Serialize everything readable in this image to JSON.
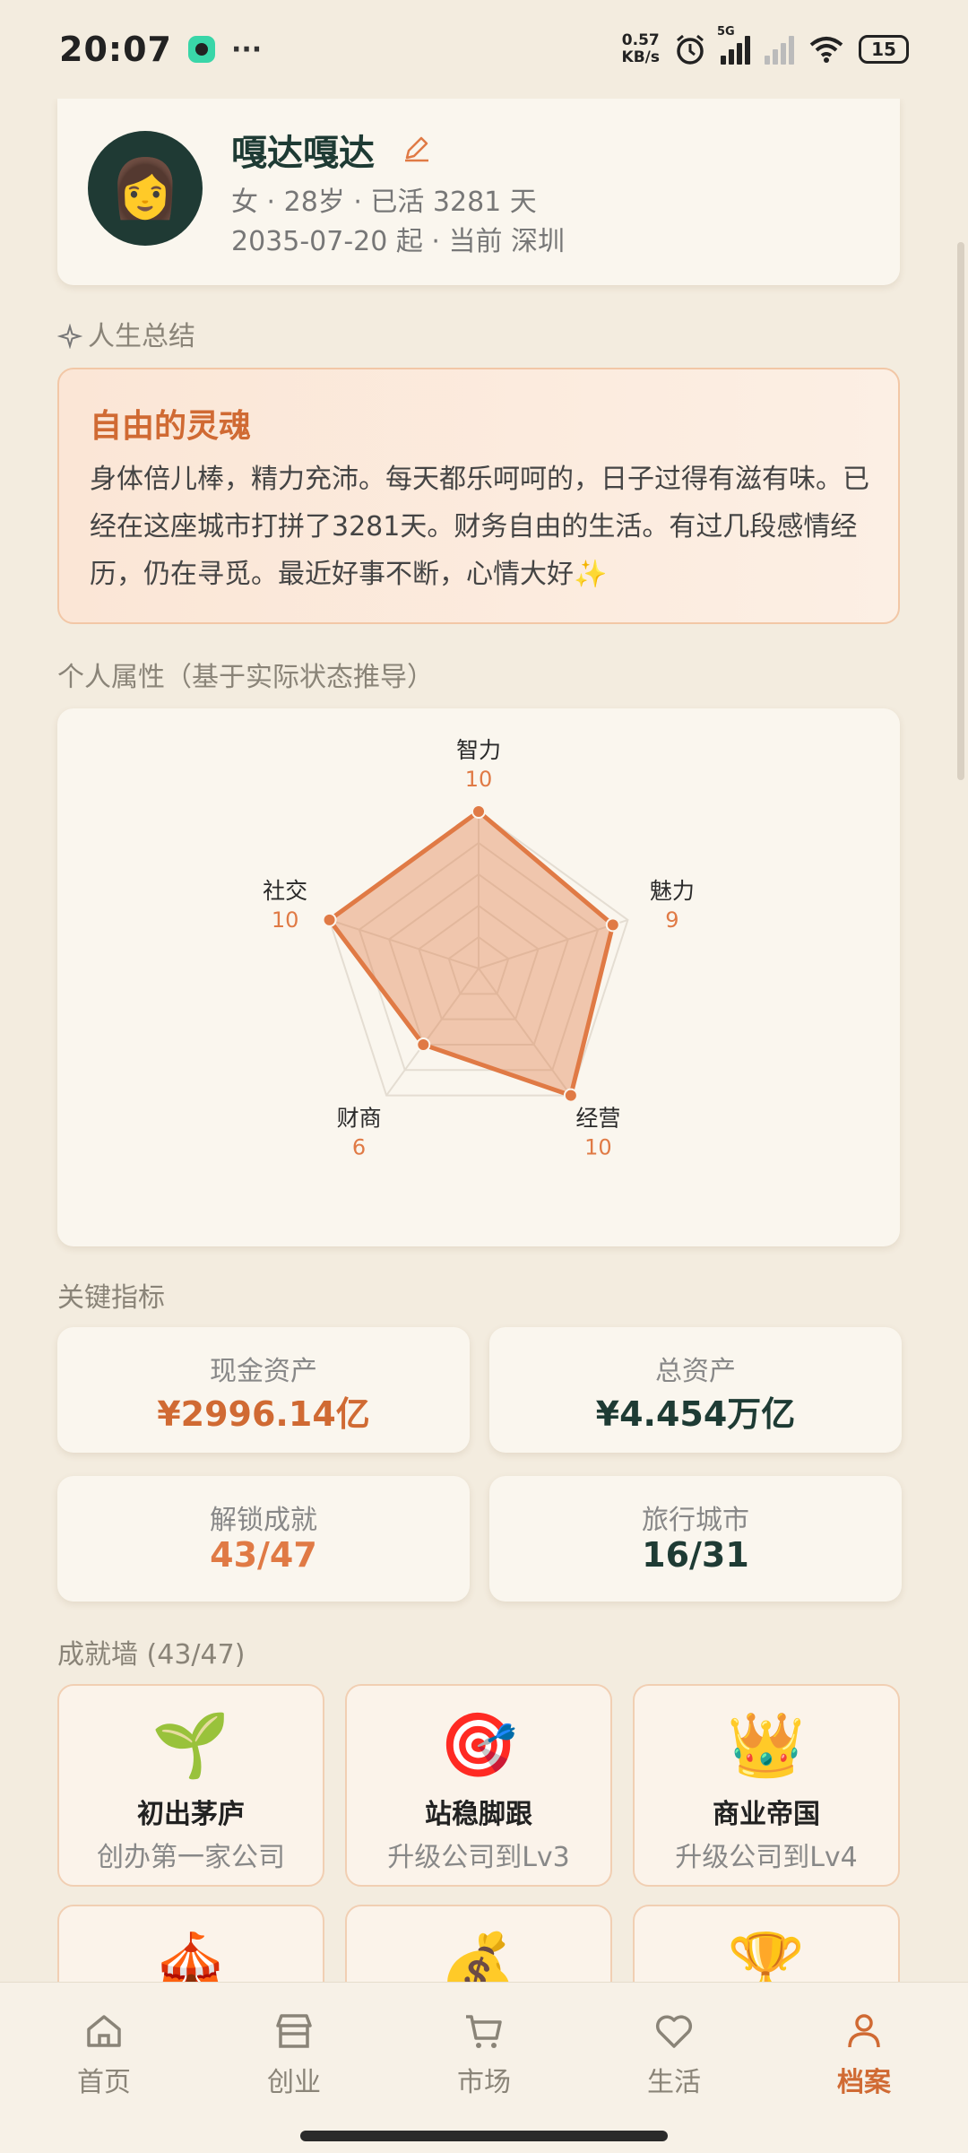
{
  "status_bar": {
    "time": "20:07",
    "more": "···",
    "net_speed_value": "0.57",
    "net_speed_unit": "KB/s",
    "network": "5G",
    "battery": "15"
  },
  "profile": {
    "avatar_emoji": "👩",
    "name": "嘎达嘎达",
    "line1": "女 · 28岁 · 已活 3281 天",
    "line2": "2035-07-20 起 · 当前 深圳"
  },
  "summary": {
    "section_title": "人生总结",
    "title": "自由的灵魂",
    "text": "身体倍儿棒，精力充沛。每天都乐呵呵的，日子过得有滋有味。已经在这座城市打拼了3281天。财务自由的生活。有过几段感情经历，仍在寻觅。最近好事不断，心情大好✨"
  },
  "attributes": {
    "section_title": "个人属性（基于实际状态推导）"
  },
  "chart_data": {
    "type": "radar",
    "max": 10,
    "axes": [
      "智力",
      "魅力",
      "经营",
      "财商",
      "社交"
    ],
    "values": [
      10,
      9,
      10,
      6,
      10
    ],
    "accent": "#e07a45"
  },
  "metrics": {
    "section_title": "关键指标",
    "items": [
      {
        "label": "现金资产",
        "value": "¥2996.14亿",
        "color": "#d06a33"
      },
      {
        "label": "总资产",
        "value": "¥4.454万亿",
        "color": "#1e3b34"
      },
      {
        "label": "解锁成就",
        "value": "43/47",
        "color": "#e07a45"
      },
      {
        "label": "旅行城市",
        "value": "16/31",
        "color": "#1e3b34"
      }
    ]
  },
  "achievements": {
    "section_title": "成就墙 (43/47)",
    "items": [
      {
        "icon": "🌱",
        "title": "初出茅庐",
        "desc": "创办第一家公司"
      },
      {
        "icon": "🎯",
        "title": "站稳脚跟",
        "desc": "升级公司到Lv3"
      },
      {
        "icon": "👑",
        "title": "商业帝国",
        "desc": "升级公司到Lv4"
      },
      {
        "icon": "🎪",
        "title": "",
        "desc": ""
      },
      {
        "icon": "💰",
        "title": "",
        "desc": ""
      },
      {
        "icon": "🏆",
        "title": "",
        "desc": ""
      }
    ]
  },
  "nav": {
    "items": [
      {
        "label": "首页",
        "icon": "home-icon"
      },
      {
        "label": "创业",
        "icon": "store-icon"
      },
      {
        "label": "市场",
        "icon": "cart-icon"
      },
      {
        "label": "生活",
        "icon": "heart-icon"
      },
      {
        "label": "档案",
        "icon": "person-icon",
        "active": true
      }
    ]
  }
}
